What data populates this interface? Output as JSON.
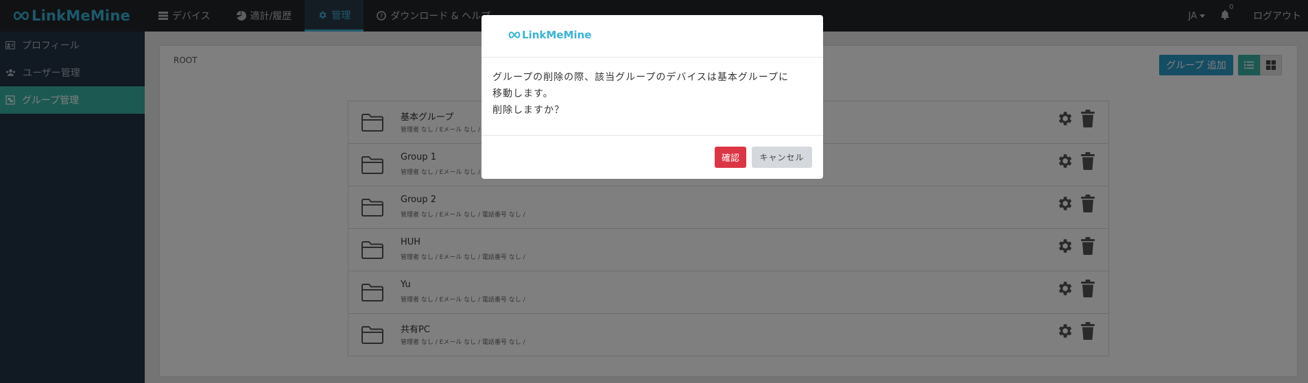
{
  "app": {
    "logo_text": "LinkMeMine",
    "accent_color": "#3ab3d8"
  },
  "nav": {
    "items": [
      {
        "label": "デバイス",
        "icon": "server-icon"
      },
      {
        "label": "適計/履歴",
        "icon": "pie-chart-icon"
      },
      {
        "label": "管理",
        "icon": "gear-icon",
        "active": true
      },
      {
        "label": "ダウンロード & ヘルプ",
        "icon": "question-circle-icon"
      }
    ]
  },
  "topbar": {
    "language": "JA",
    "notification_count": "0",
    "logout_label": "ログアウト"
  },
  "sidebar": {
    "items": [
      {
        "label": "プロフィール",
        "icon": "id-card-icon"
      },
      {
        "label": "ユーザー管理",
        "icon": "users-icon"
      },
      {
        "label": "グループ管理",
        "icon": "group-icon",
        "active": true
      }
    ]
  },
  "main": {
    "breadcrumb": "ROOT",
    "add_group_label": "グループ 追加"
  },
  "groups": [
    {
      "name": "基本グループ",
      "meta": "管理者 なし / Eメール なし / 電話番号 なし /"
    },
    {
      "name": "Group 1",
      "meta": "管理者 なし / Eメール なし / 電話番号 なし /"
    },
    {
      "name": "Group 2",
      "meta": "管理者 なし / Eメール なし / 電話番号 なし /"
    },
    {
      "name": "HUH",
      "meta": "管理者 なし / Eメール なし / 電話番号 なし /"
    },
    {
      "name": "Yu",
      "meta": "管理者 なし / Eメール なし / 電話番号 なし /"
    },
    {
      "name": "共有PC",
      "meta": "管理者 なし / Eメール なし / 電話番号 なし /"
    }
  ],
  "modal": {
    "logo_text": "LinkMeMine",
    "message_line1": "グループの削除の際、該当グループのデバイスは基本グループに",
    "message_line2": "移動します。",
    "message_line3": "削除しますか？",
    "confirm_label": "確認",
    "cancel_label": "キャンセル"
  }
}
